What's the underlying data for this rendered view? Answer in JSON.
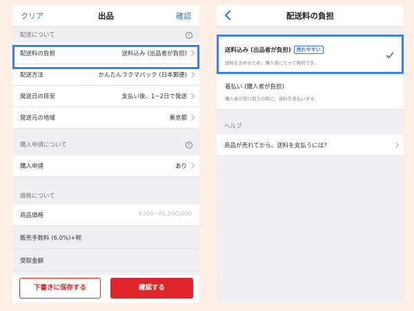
{
  "left": {
    "nav": {
      "clear": "クリア",
      "title": "出品",
      "confirm": "確認"
    },
    "shipping_section": "配送について",
    "shipping_rows": [
      {
        "label": "配送料の負担",
        "value": "送料込み (出品者が負担)"
      },
      {
        "label": "配送方法",
        "value": "かんたんラクマパック (日本郵便)"
      },
      {
        "label": "発送日の目安",
        "value": "支払い後、1~2日で発送"
      },
      {
        "label": "発送元の地域",
        "value": "東京都"
      }
    ],
    "purchase_section": "購入申請について",
    "purchase_row": {
      "label": "購入申請",
      "value": "あり"
    },
    "price_section": "価格について",
    "price_row": {
      "label": "商品価格",
      "placeholder": "¥300~¥2,000,000"
    },
    "fee_label": "販売手数料 (6.0%)+税",
    "receive_label": "受取金額",
    "buttons": {
      "draft": "下書きに保存する",
      "confirm": "確認する"
    }
  },
  "right": {
    "nav": {
      "title": "配送料の負担"
    },
    "options": [
      {
        "title": "送料込み (出品者が負担)",
        "badge": "売れやすい",
        "desc": "送料を含めるため、購入者にとって親切です。",
        "selected": true
      },
      {
        "title": "着払い (購入者が負担)",
        "desc": "購入者が受け取りの時に、送料を支払います。",
        "selected": false
      }
    ],
    "help_section": "ヘルプ",
    "help_link": "商品が売れてから、送料を支払うには？"
  },
  "colors": {
    "accent_blue": "#3b6fd4",
    "highlight": "#3a7ff0",
    "primary_red": "#e0262b",
    "background": "#fdeee6"
  },
  "icons": {
    "help": "question-circle-icon",
    "chevron": "chevron-right-icon",
    "back": "chevron-left-icon",
    "check": "checkmark-icon"
  }
}
